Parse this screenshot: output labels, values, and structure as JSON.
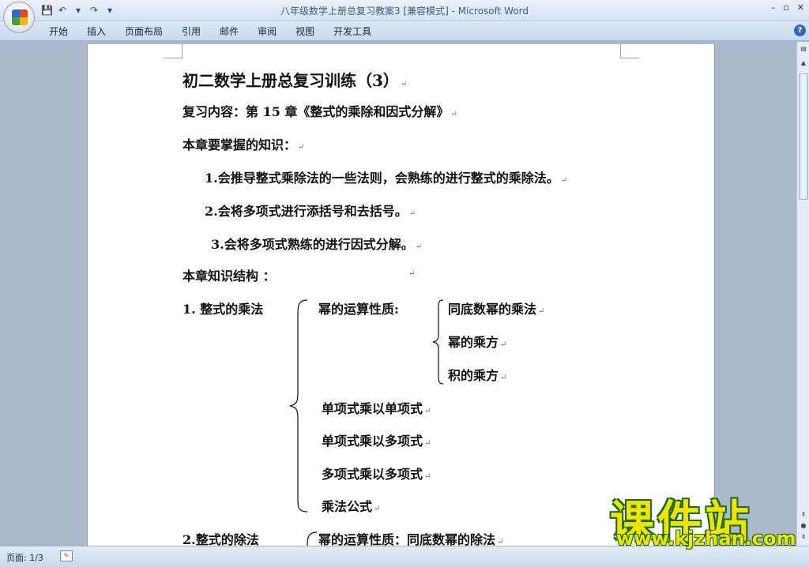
{
  "window": {
    "title_doc": "八年级数学上册总复习教案3 [兼容模式] - ",
    "title_app": "Microsoft Word",
    "minimize": "–",
    "restore": "▫",
    "close": "✕"
  },
  "qat": {
    "save_icon": "💾",
    "undo_icon": "↶",
    "undo_dropdown": "▾",
    "redo_icon": "↷",
    "customize": "▾"
  },
  "ribbon": {
    "tabs": [
      "开始",
      "插入",
      "页面布局",
      "引用",
      "邮件",
      "审阅",
      "视图",
      "开发工具"
    ],
    "help": "?"
  },
  "document": {
    "title": "初二数学上册总复习训练（3）",
    "review_content": "复习内容：第 15 章《整式的乘除和因式分解》",
    "knowledge_heading": "本章要掌握的知识：",
    "items": [
      "1.会推导整式乘除法的一些法则，会熟练的进行整式的乘除法。",
      "2.会将多项式进行添括号和去括号。",
      "3.会将多项式熟练的进行因式分解。"
    ],
    "structure_heading": "本章知识结构 ：",
    "section1": {
      "label": "1. 整式的乘法",
      "power_props": "幂的运算性质:",
      "power_items": [
        "同底数幂的乘法",
        "幂的乘方",
        "积的乘方"
      ],
      "other_items": [
        "单项式乘以单项式",
        "单项式乘以多项式",
        "多项式乘以多项式",
        "乘法公式"
      ]
    },
    "section2": {
      "label": "2.整式的除法",
      "power_props": "幂的运算性质：同底数幂的除法"
    },
    "para_mark": "↵"
  },
  "status": {
    "page": "页面: 1/3"
  },
  "watermark": {
    "logo": "课件站",
    "url": "www.kjzhan.com"
  }
}
